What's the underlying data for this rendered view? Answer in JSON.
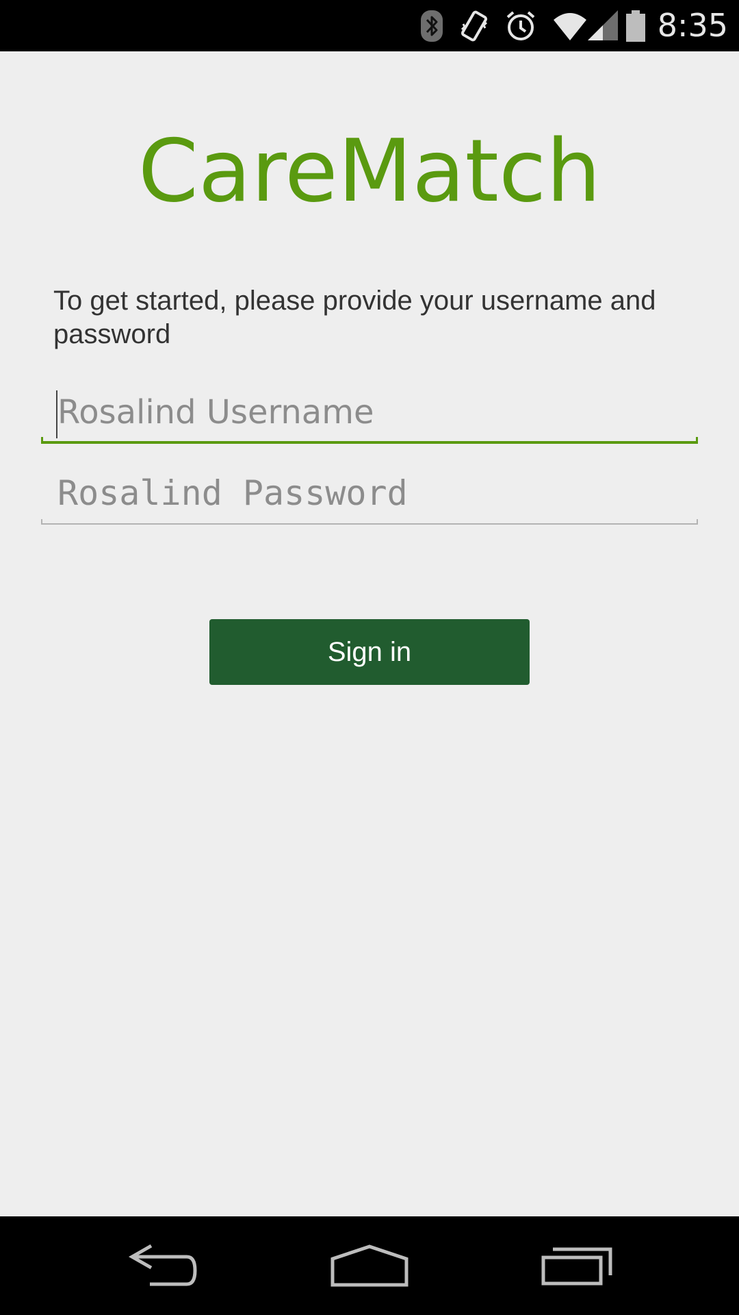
{
  "status_bar": {
    "time": "8:35",
    "icons": [
      "bluetooth-icon",
      "vibrate-icon",
      "alarm-icon",
      "wifi-icon",
      "cell-signal-icon",
      "battery-icon"
    ]
  },
  "app": {
    "title": "CareMatch",
    "brand_color": "#5a9a10",
    "instructions": "To get started, please provide your username and password"
  },
  "form": {
    "username": {
      "placeholder": "Rosalind Username",
      "value": ""
    },
    "password": {
      "placeholder": "Rosalind Password",
      "value": ""
    },
    "submit_label": "Sign in",
    "submit_color": "#215c2f"
  },
  "nav_bar": {
    "buttons": [
      "back-icon",
      "home-icon",
      "recents-icon"
    ]
  }
}
